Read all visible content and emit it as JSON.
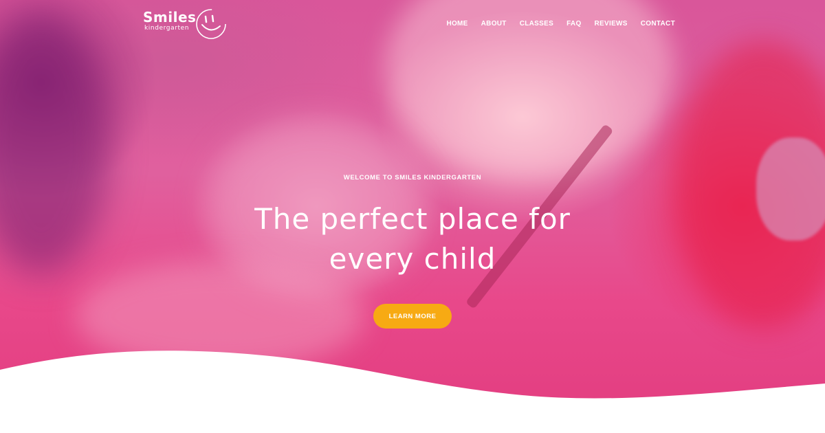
{
  "brand": {
    "name": "Smiles",
    "tagline": "kindergarten"
  },
  "nav": {
    "items": [
      "HOME",
      "ABOUT",
      "CLASSES",
      "FAQ",
      "REVIEWS",
      "CONTACT"
    ]
  },
  "hero": {
    "eyebrow": "WELCOME TO SMILES KINDERGARTEN",
    "headline_line1": "The perfect place for",
    "headline_line2": "every child",
    "cta_label": "LEARN MORE"
  },
  "colors": {
    "accent": "#f7aa13",
    "overlay": "#e0609e",
    "text": "#ffffff"
  }
}
